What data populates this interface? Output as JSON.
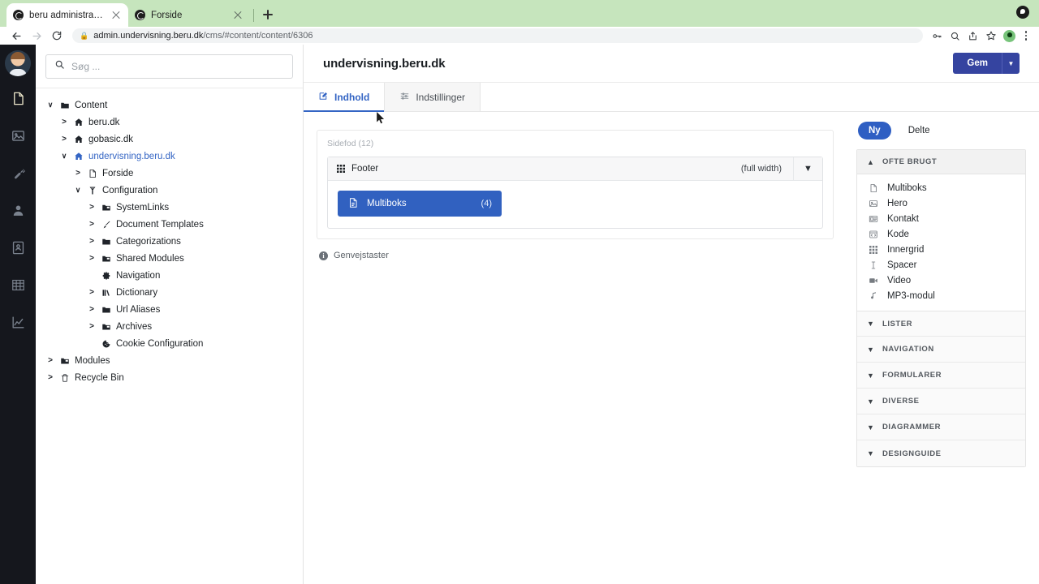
{
  "browser": {
    "tabs": [
      {
        "title": "beru administration",
        "active": true,
        "favicon": "globe-icon"
      },
      {
        "title": "Forside",
        "active": false,
        "favicon": "globe-icon"
      }
    ],
    "new_tab_label": "+",
    "url_host": "admin.undervisning.beru.dk",
    "url_path": "/cms/#content/content/6306",
    "toolbar_icons": [
      "back-icon",
      "forward-icon",
      "reload-icon",
      "lock-icon",
      "password-key-icon",
      "search-page-icon",
      "share-icon",
      "bookmark-star-icon",
      "profile-avatar-icon",
      "chrome-menu-icon"
    ],
    "tabstrip_color": "#c6e5bd"
  },
  "rail": {
    "avatar_label": "user-avatar",
    "items": [
      {
        "name": "content-icon",
        "active": true
      },
      {
        "name": "media-icon",
        "active": false
      },
      {
        "name": "settings-wrench-icon",
        "active": false
      },
      {
        "name": "users-icon",
        "active": false
      },
      {
        "name": "members-icon",
        "active": false
      },
      {
        "name": "forms-table-icon",
        "active": false
      },
      {
        "name": "analytics-chart-icon",
        "active": false
      }
    ]
  },
  "search": {
    "placeholder": "Søg ...",
    "value": "",
    "icon": "search-icon"
  },
  "tree": [
    {
      "label": "Content",
      "depth": 0,
      "caret": "open",
      "icon": "folder-icon",
      "selected": false
    },
    {
      "label": "beru.dk",
      "depth": 1,
      "caret": "closed",
      "icon": "home-icon",
      "selected": false
    },
    {
      "label": "gobasic.dk",
      "depth": 1,
      "caret": "closed",
      "icon": "home-icon",
      "selected": false
    },
    {
      "label": "undervisning.beru.dk",
      "depth": 1,
      "caret": "open",
      "icon": "home-icon",
      "selected": true
    },
    {
      "label": "Forside",
      "depth": 2,
      "caret": "closed",
      "icon": "document-icon",
      "selected": false
    },
    {
      "label": "Configuration",
      "depth": 2,
      "caret": "open",
      "icon": "config-icon",
      "selected": false
    },
    {
      "label": "SystemLinks",
      "depth": 3,
      "caret": "closed",
      "icon": "folders-icon",
      "selected": false
    },
    {
      "label": "Document Templates",
      "depth": 3,
      "caret": "closed",
      "icon": "brush-icon",
      "selected": false
    },
    {
      "label": "Categorizations",
      "depth": 3,
      "caret": "closed",
      "icon": "folder-icon",
      "selected": false
    },
    {
      "label": "Shared Modules",
      "depth": 3,
      "caret": "closed",
      "icon": "folders-icon",
      "selected": false
    },
    {
      "label": "Navigation",
      "depth": 3,
      "caret": "none",
      "icon": "gear-icon",
      "selected": false
    },
    {
      "label": "Dictionary",
      "depth": 3,
      "caret": "closed",
      "icon": "books-icon",
      "selected": false
    },
    {
      "label": "Url Aliases",
      "depth": 3,
      "caret": "closed",
      "icon": "folder-icon",
      "selected": false
    },
    {
      "label": "Archives",
      "depth": 3,
      "caret": "closed",
      "icon": "folders-icon",
      "selected": false
    },
    {
      "label": "Cookie Configuration",
      "depth": 3,
      "caret": "none",
      "icon": "cookie-icon",
      "selected": false
    },
    {
      "label": "Modules",
      "depth": 0,
      "caret": "closed",
      "icon": "folders-icon",
      "selected": false
    },
    {
      "label": "Recycle Bin",
      "depth": 0,
      "caret": "closed",
      "icon": "trash-icon",
      "selected": false
    }
  ],
  "header": {
    "title": "undervisning.beru.dk",
    "save_label": "Gem",
    "save_caret": "▾",
    "accent": "#3544a0"
  },
  "tabs": [
    {
      "label": "Indhold",
      "icon": "edit-square-icon",
      "active": true
    },
    {
      "label": "Indstillinger",
      "icon": "sliders-icon",
      "active": false
    }
  ],
  "canvas": {
    "grid_label": "Sidefod (12)",
    "row": {
      "icon": "grid-icon",
      "name": "Footer",
      "width_label": "(full width)",
      "caret": "chevron-down-icon"
    },
    "block": {
      "icon": "document-icon",
      "label": "Multiboks",
      "count": "(4)",
      "color": "#3161c0"
    },
    "shortcuts_label": "Genvejstaster",
    "shortcuts_icon": "info-icon"
  },
  "rightpane": {
    "toggle": {
      "new_label": "Ny",
      "shared_label": "Delte",
      "active": "Ny",
      "accent": "#2f5fc3"
    },
    "sections": [
      {
        "title": "OFTE BRUGT",
        "expanded": true,
        "chevron": "chevron-up-icon",
        "items": [
          {
            "label": "Multiboks",
            "icon": "document-icon"
          },
          {
            "label": "Hero",
            "icon": "image-icon"
          },
          {
            "label": "Kontakt",
            "icon": "contact-card-icon"
          },
          {
            "label": "Kode",
            "icon": "code-icon"
          },
          {
            "label": "Innergrid",
            "icon": "grid-icon"
          },
          {
            "label": "Spacer",
            "icon": "spacer-icon"
          },
          {
            "label": "Video",
            "icon": "video-icon"
          },
          {
            "label": "MP3-modul",
            "icon": "music-note-icon"
          }
        ]
      },
      {
        "title": "LISTER",
        "expanded": false,
        "chevron": "chevron-down-icon"
      },
      {
        "title": "NAVIGATION",
        "expanded": false,
        "chevron": "chevron-down-icon"
      },
      {
        "title": "FORMULARER",
        "expanded": false,
        "chevron": "chevron-down-icon"
      },
      {
        "title": "DIVERSE",
        "expanded": false,
        "chevron": "chevron-down-icon"
      },
      {
        "title": "DIAGRAMMER",
        "expanded": false,
        "chevron": "chevron-down-icon"
      },
      {
        "title": "DESIGNGUIDE",
        "expanded": false,
        "chevron": "chevron-down-icon"
      }
    ]
  }
}
